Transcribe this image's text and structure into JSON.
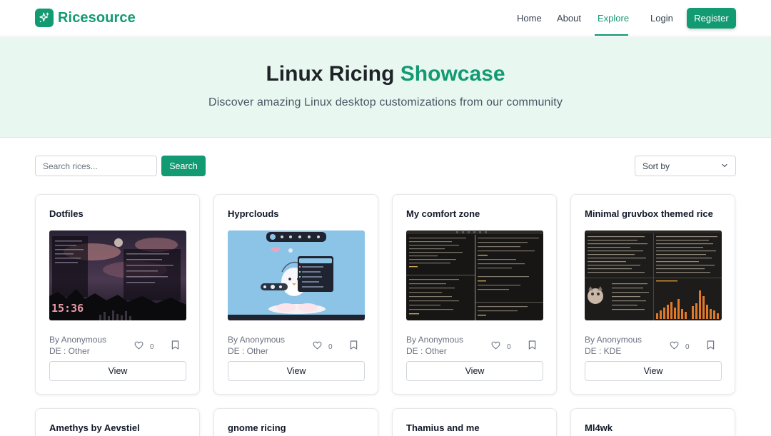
{
  "brand": {
    "name": "Ricesource",
    "icon": "sparkle-icon",
    "color": "#129a72"
  },
  "nav": {
    "home": "Home",
    "about": "About",
    "explore": "Explore",
    "login": "Login",
    "register": "Register",
    "active": "Explore"
  },
  "hero": {
    "title_main": "Linux Ricing ",
    "title_accent": "Showcase",
    "subtitle": "Discover amazing Linux desktop customizations from our community"
  },
  "search": {
    "placeholder": "Search rices...",
    "button": "Search",
    "sort_label": "Sort by"
  },
  "cards": [
    {
      "title": "Dotfiles",
      "author": "By Anonymous",
      "de": "DE : Other",
      "likes": "0",
      "view": "View"
    },
    {
      "title": "Hyprclouds",
      "author": "By Anonymous",
      "de": "DE : Other",
      "likes": "0",
      "view": "View"
    },
    {
      "title": "My comfort zone",
      "author": "By Anonymous",
      "de": "DE : Other",
      "likes": "0",
      "view": "View"
    },
    {
      "title": "Minimal gruvbox themed rice",
      "author": "By Anonymous",
      "de": "DE : KDE",
      "likes": "0",
      "view": "View"
    },
    {
      "title": "Amethys by Aevstiel"
    },
    {
      "title": "gnome ricing"
    },
    {
      "title": "Thamius and me"
    },
    {
      "title": "Ml4wk"
    }
  ],
  "thumbnails": {
    "dotfiles_clock": "15:36"
  }
}
